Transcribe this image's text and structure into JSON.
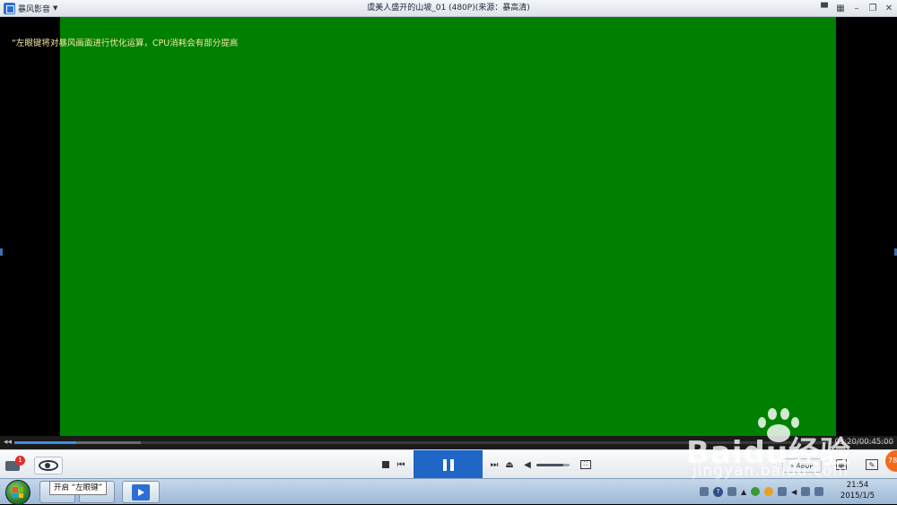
{
  "titlebar": {
    "app_name": "暴风影音",
    "window_title": "虞美人盛开的山坡_01 (480P)(来源：暴高清)"
  },
  "video": {
    "osd_message": "“左眼键将对暴风画面进行优化运算，CPU消耗会有部分提高",
    "background_color": "#008000"
  },
  "seekbar": {
    "time_readout": "03:20/00:45:00",
    "progress_fraction": 0.07
  },
  "controls": {
    "toolbox_badge": "1",
    "quality_label": "480P",
    "orange_badge": "78",
    "volume_fraction": 0.8
  },
  "taskbar": {
    "tooltip": "开启 “左眼键”",
    "clock_time": "21:54",
    "clock_date": "2015/1/5"
  },
  "watermark": {
    "brand": "Baidu经验",
    "url": "jingyan.baidu.com"
  },
  "colors": {
    "accent_blue": "#1f66c7",
    "badge_red": "#e0302a",
    "orange": "#f26b1d"
  }
}
